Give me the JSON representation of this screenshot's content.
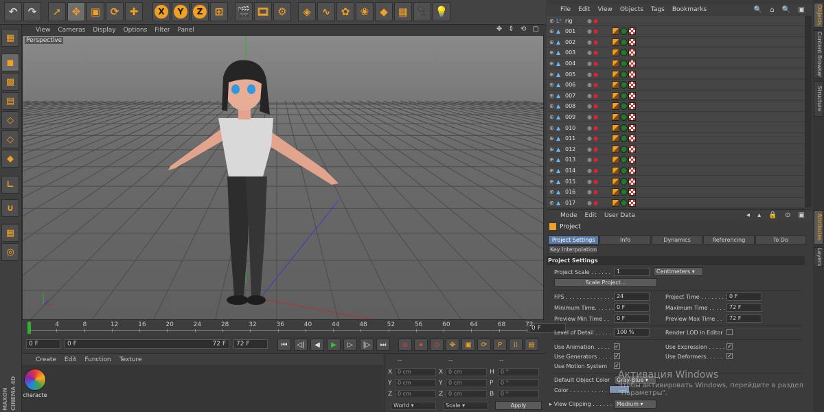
{
  "toolbar": {
    "groups": [
      [
        {
          "glyph": "↶",
          "name": "undo-icon"
        },
        {
          "glyph": "↷",
          "name": "redo-icon"
        }
      ],
      [
        {
          "glyph": "➚",
          "name": "live-selection-icon"
        },
        {
          "glyph": "✥",
          "name": "move-icon"
        },
        {
          "glyph": "▣",
          "name": "scale-icon"
        },
        {
          "glyph": "⟳",
          "name": "rotate-icon"
        },
        {
          "glyph": "✚",
          "name": "create-icon"
        }
      ],
      [
        {
          "glyph": "X",
          "name": "x-axis-lock-icon",
          "axis": true
        },
        {
          "glyph": "Y",
          "name": "y-axis-lock-icon",
          "axis": true
        },
        {
          "glyph": "Z",
          "name": "z-axis-lock-icon",
          "axis": true
        },
        {
          "glyph": "⊞",
          "name": "coordinate-system-icon"
        }
      ],
      [
        {
          "glyph": "🎬",
          "name": "render-view-icon"
        },
        {
          "glyph": "🎞",
          "name": "render-picture-viewer-icon"
        },
        {
          "glyph": "⚙",
          "name": "render-settings-icon"
        }
      ],
      [
        {
          "glyph": "◈",
          "name": "cube-icon"
        },
        {
          "glyph": "∿",
          "name": "spline-icon"
        },
        {
          "glyph": "✿",
          "name": "nurbs-icon"
        },
        {
          "glyph": "❀",
          "name": "array-icon"
        },
        {
          "glyph": "◆",
          "name": "deformer-icon"
        },
        {
          "glyph": "▦",
          "name": "floor-icon"
        },
        {
          "glyph": "🎥",
          "name": "camera-icon"
        },
        {
          "glyph": "💡",
          "name": "light-icon"
        }
      ]
    ]
  },
  "left_tools": [
    {
      "glyph": "▦",
      "name": "make-editable-icon"
    },
    {
      "glyph": "◼",
      "name": "model-mode-icon"
    },
    {
      "glyph": "▩",
      "name": "texture-mode-icon"
    },
    {
      "glyph": "▤",
      "name": "workplane-mode-icon"
    },
    {
      "glyph": "◇",
      "name": "points-mode-icon"
    },
    {
      "glyph": "◇",
      "name": "edges-mode-icon"
    },
    {
      "glyph": "◆",
      "name": "polygons-mode-icon"
    },
    {
      "glyph": "∟",
      "name": "axis-mode-icon"
    },
    {
      "glyph": "∪",
      "name": "snap-icon"
    },
    {
      "glyph": "▦",
      "name": "workplane-lock-icon"
    },
    {
      "glyph": "◎",
      "name": "soft-selection-icon"
    }
  ],
  "brand": {
    "line1": "MAXON",
    "line2": "CINEMA 4D"
  },
  "viewport": {
    "menu": [
      "View",
      "Cameras",
      "Display",
      "Options",
      "Filter",
      "Panel"
    ],
    "nav_icons": "✥ ⇕ ⟲ ▢",
    "label": "Perspective"
  },
  "timeline": {
    "ticks": [
      "0",
      "4",
      "8",
      "12",
      "16",
      "20",
      "24",
      "28",
      "32",
      "36",
      "40",
      "44",
      "48",
      "52",
      "56",
      "60",
      "64",
      "68",
      "72"
    ],
    "current_frame": "0 F",
    "start": "0 F",
    "range_start": "0 F",
    "range_end": "72 F",
    "end": "72 F"
  },
  "transport": [
    {
      "glyph": "⏮",
      "name": "go-to-start-icon"
    },
    {
      "glyph": "◁|",
      "name": "previous-key-icon"
    },
    {
      "glyph": "◀",
      "name": "previous-frame-icon"
    },
    {
      "glyph": "▶",
      "name": "play-icon"
    },
    {
      "glyph": "▷",
      "name": "next-frame-icon"
    },
    {
      "glyph": "|▷",
      "name": "next-key-icon"
    },
    {
      "glyph": "⏭",
      "name": "go-to-end-icon"
    }
  ],
  "keys": [
    {
      "glyph": "⊘",
      "name": "record-off-icon"
    },
    {
      "glyph": "⏺",
      "name": "record-active-icon"
    },
    {
      "glyph": "⊙",
      "name": "autokey-icon"
    },
    {
      "glyph": "✥",
      "name": "key-position-icon"
    },
    {
      "glyph": "▣",
      "name": "key-scale-icon"
    },
    {
      "glyph": "⟳",
      "name": "key-rotation-icon"
    },
    {
      "glyph": "P",
      "name": "key-parameter-icon"
    },
    {
      "glyph": "⁞⁞",
      "name": "key-point-level-icon"
    },
    {
      "glyph": "▤",
      "name": "timeline-icon"
    }
  ],
  "material": {
    "menu": [
      "Create",
      "Edit",
      "Function",
      "Texture"
    ],
    "name": "characte"
  },
  "coordinates": {
    "header": [
      "--",
      "--",
      "--"
    ],
    "rows": [
      {
        "a": "X",
        "av": "0 cm",
        "b": "X",
        "bv": "0 cm",
        "c": "H",
        "cv": "0 °"
      },
      {
        "a": "Y",
        "av": "0 cm",
        "b": "Y",
        "bv": "0 cm",
        "c": "P",
        "cv": "0 °"
      },
      {
        "a": "Z",
        "av": "0 cm",
        "b": "Z",
        "bv": "0 cm",
        "c": "B",
        "cv": "0 °"
      }
    ],
    "mode1": "World",
    "mode2": "Scale",
    "apply": "Apply"
  },
  "object_manager": {
    "menu": [
      "File",
      "Edit",
      "View",
      "Objects",
      "Tags",
      "Bookmarks"
    ],
    "icons": "🔍 ⌂ 🔍 ▣",
    "objects": [
      "rig",
      "001",
      "002",
      "003",
      "004",
      "005",
      "006",
      "007",
      "008",
      "009",
      "010",
      "011",
      "012",
      "013",
      "014",
      "015",
      "016",
      "017"
    ]
  },
  "attributes": {
    "menu": [
      "Mode",
      "Edit",
      "User Data"
    ],
    "icons": "◂ ▴ 🔒 ⊙ ▣",
    "title": "Project",
    "tabs": [
      "Project Settings",
      "Info",
      "Dynamics",
      "Referencing",
      "To Do"
    ],
    "tab2": "Key Interpolation",
    "section": "Project Settings",
    "project_scale_label": "Project Scale . . . . . .",
    "project_scale_value": "1",
    "project_scale_unit": "Centimeters",
    "scale_project_button": "Scale Project...",
    "fps_label": "FPS . . . . . . . . . . . . . .",
    "fps_value": "24",
    "min_time_label": "Minimum Time. . . . . .",
    "min_time_value": "0 F",
    "preview_min_label": "Preview Min Time . .",
    "preview_min_value": "0 F",
    "project_time_label": "Project Time . . . . . . . .",
    "project_time_value": "0 F",
    "max_time_label": "Maximum Time . . . . . .",
    "max_time_value": "72 F",
    "preview_max_label": "Preview Max Time . .",
    "preview_max_value": "72 F",
    "lod_label": "Level of Detail . . . . . .",
    "lod_value": "100 %",
    "render_lod_label": "Render LOD in Editor",
    "use_animation_label": "Use Animation. . . . .",
    "use_generators_label": "Use Generators . . . .",
    "use_motion_label": "Use Motion System",
    "use_expression_label": "Use Expression . . . . .",
    "use_deformers_label": "Use Deformers. . . . .",
    "default_color_label": "Default Object Color",
    "default_color_value": "Gray-Blue",
    "color_label": "Color . . . . . . . . . . . . . .",
    "view_clipping_label": "View Clipping . . . . . .",
    "view_clipping_value": "Medium"
  },
  "right_tabs": [
    "Objects",
    "Content Browser",
    "Structure",
    "Attributes",
    "Layers"
  ],
  "watermark": {
    "line1": "Активация Windows",
    "line2": "Чтобы активировать Windows, перейдите в раздел",
    "line3": "\"Параметры\"."
  }
}
